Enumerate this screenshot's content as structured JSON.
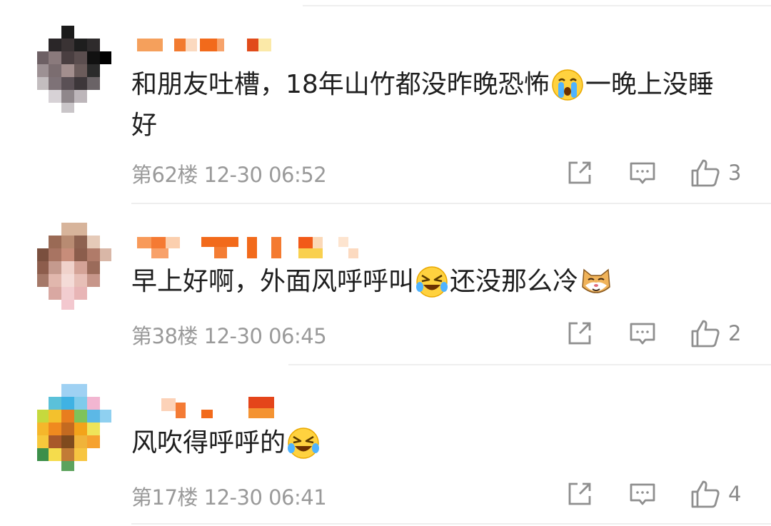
{
  "comments": [
    {
      "text_parts": [
        "和朋友吐槽，18年山竹都没昨晚恐怖",
        "一晚上没睡好"
      ],
      "emoji": "crying-face",
      "floor": "第62楼",
      "time": "12-30 06:52",
      "likes": "3"
    },
    {
      "text_parts": [
        "早上好啊，外面风呼呼叫",
        "还没那么冷"
      ],
      "emoji": "laughing-face",
      "emoji2": "cat-face",
      "floor": "第38楼",
      "time": "12-30 06:45",
      "likes": "2"
    },
    {
      "text_parts": [
        "风吹得呼呼的"
      ],
      "emoji": "laughing-face",
      "floor": "第17楼",
      "time": "12-30 06:41",
      "likes": "4"
    }
  ],
  "icons": {
    "share": "share-icon",
    "reply": "reply-icon",
    "like": "thumbs-up-icon"
  },
  "colors": {
    "text": "#1f1f1f",
    "meta": "#9a9a9a",
    "icon": "#8f8f8f",
    "name_blur": "#f26a1b"
  }
}
